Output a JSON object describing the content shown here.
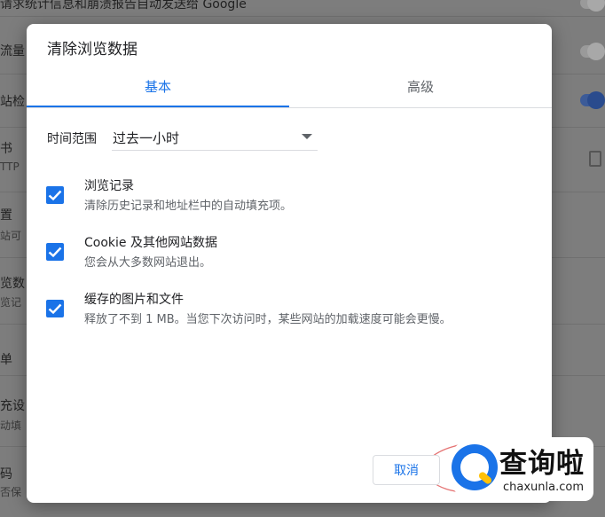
{
  "background": {
    "rows": [
      {
        "title": "请求统计信息和崩溃报告自动发送给 Google",
        "sub": ""
      },
      {
        "title": "流量",
        "sub": ""
      },
      {
        "title": "站检",
        "sub": ""
      },
      {
        "title": "书",
        "sub": "TTP"
      },
      {
        "title": "置",
        "sub": "站可"
      },
      {
        "title": "览数",
        "sub": "览记"
      },
      {
        "title": "单",
        "sub": ""
      },
      {
        "title": "充设",
        "sub": "动填"
      },
      {
        "title": "码",
        "sub": "否保"
      }
    ]
  },
  "dialog": {
    "title": "清除浏览数据",
    "tabs": {
      "basic": "基本",
      "advanced": "高级"
    },
    "time_range": {
      "label": "时间范围",
      "value": "过去一小时"
    },
    "options": [
      {
        "title": "浏览记录",
        "desc": "清除历史记录和地址栏中的自动填充项。",
        "checked": true
      },
      {
        "title": "Cookie 及其他网站数据",
        "desc": "您会从大多数网站退出。",
        "checked": true
      },
      {
        "title": "缓存的图片和文件",
        "desc": "释放了不到 1 MB。当您下次访问时，某些网站的加载速度可能会更慢。",
        "checked": true
      }
    ],
    "cancel_label": "取消"
  },
  "watermark": {
    "cn": "查询啦",
    "en": "chaxunla.com"
  },
  "colors": {
    "accent": "#1a73e8",
    "overlay": "#7f7f7f"
  }
}
